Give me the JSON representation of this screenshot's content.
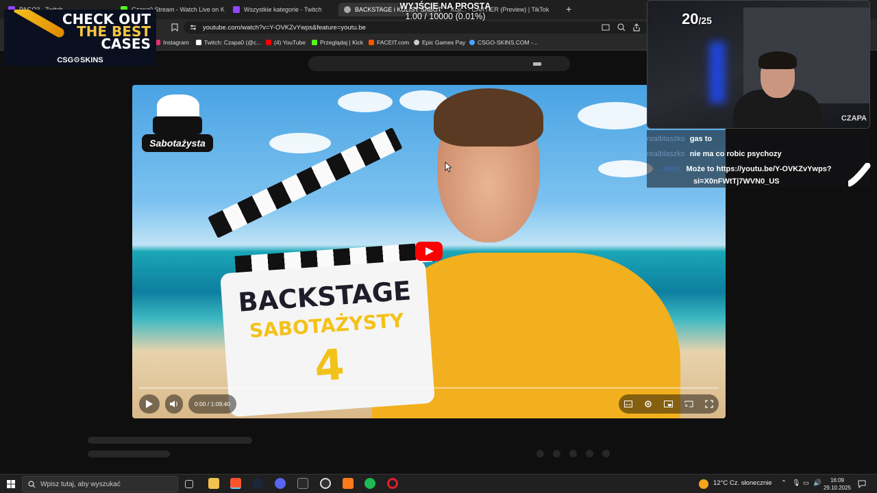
{
  "browser": {
    "tabs": [
      {
        "label": "PAGO3 - Twitch",
        "color": "#9146ff"
      },
      {
        "label": "Czapa0 Stream - Watch Live on Kick",
        "color": "#53fc18"
      },
      {
        "label": "Wszystkie kategorie - Twitch",
        "color": "#9146ff"
      },
      {
        "label": "BACKSTAGE i KULISY SABOTA",
        "color": "#aaaaaa",
        "active": true
      },
      {
        "label": "Koji... - CARTIER (Preview) | TikTok",
        "color": "#ffffff"
      }
    ],
    "new_tab": "+",
    "url": "youtube.com/watch?v=Y-OVKZvYwps&feature=youtu.be",
    "bookmarks": [
      {
        "label": "Instagram",
        "color": "#e1306c"
      },
      {
        "label": "Twitch: Czapa0 (@c...",
        "color": "#ffffff"
      },
      {
        "label": "(4) YouTube",
        "color": "#ff0000"
      },
      {
        "label": "Przeglądaj | Kick",
        "color": "#53fc18"
      },
      {
        "label": "FACEIT.com",
        "color": "#ff5500"
      },
      {
        "label": "Epic Games Pay",
        "color": "#cccccc"
      },
      {
        "label": "CSGO-SKINS.COM -...",
        "color": "#4aa3ff"
      }
    ]
  },
  "overlay": {
    "goal_title": "WYJŚCIE NA PROSTĄ",
    "goal_progress": "1.00 / 10000 (0.01%)",
    "ad": {
      "line1": "CHECK OUT",
      "line2": "THE BEST",
      "line3": "CASES",
      "brand": "CSG⚙SKINS"
    }
  },
  "video": {
    "logo_text": "Sabotażysta",
    "board_line1": "BACKSTAGE",
    "board_line2": "SABOTAŻYSTY",
    "board_line3": "4",
    "time": "0:00 / 1:09:40"
  },
  "webcam": {
    "score": "20",
    "score_total": "25",
    "name": "CZAPA"
  },
  "chat": [
    {
      "user": "realblaszko",
      "message": "gas to"
    },
    {
      "user": "realblaszko",
      "message": "nie ma co robic psychozy"
    },
    {
      "user": "...hinol",
      "message": "Może to https://youtu.be/Y-OVKZvYwps?"
    },
    {
      "user": "",
      "message": "si=X0nFWtTj7WVN0_US"
    }
  ],
  "taskbar": {
    "search_placeholder": "Wpisz tutaj, aby wyszukać",
    "weather": "12°C  Cz. słonecznie",
    "time": "16:09",
    "date": "29.10.2025"
  }
}
